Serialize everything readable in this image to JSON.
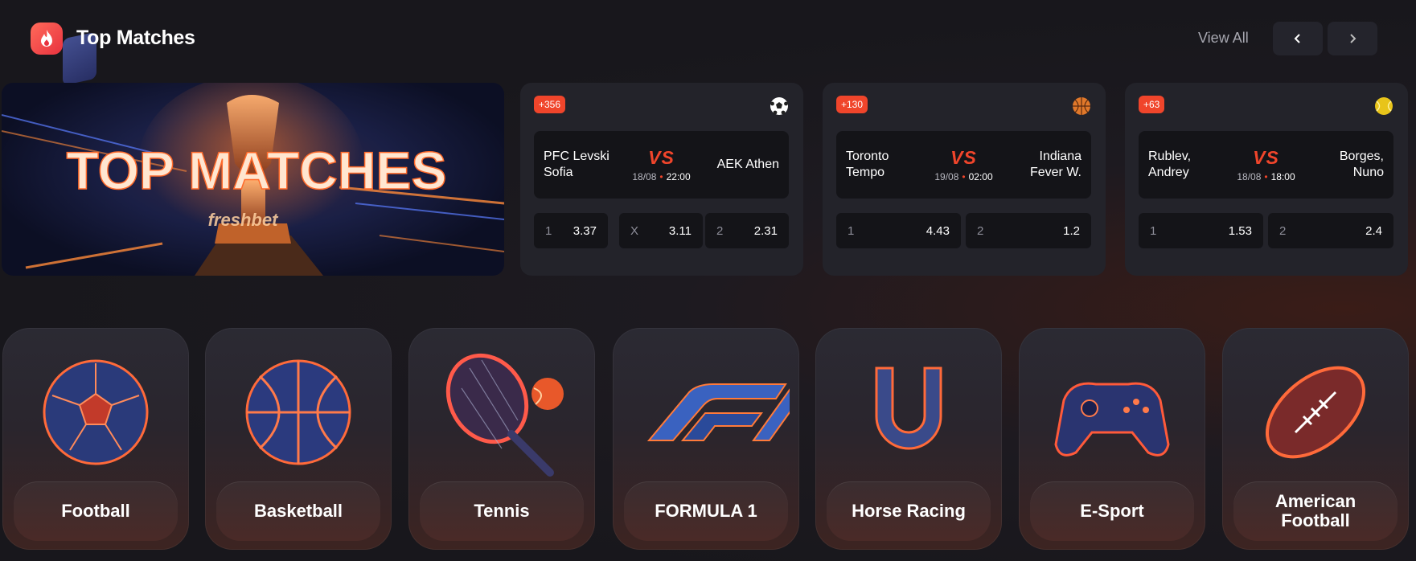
{
  "header": {
    "title": "Top Matches",
    "view_all": "View All",
    "prev_icon": "chevron-left-icon",
    "next_icon": "chevron-right-icon",
    "logo_icon": "flame-icon"
  },
  "banner": {
    "text": "TOP MATCHES",
    "brand": "freshbet"
  },
  "matches": [
    {
      "count_badge": "+356",
      "sport_icon": "football-icon",
      "team_a": [
        "PFC Levski",
        "Sofia"
      ],
      "team_b": [
        "AEK Athen"
      ],
      "vs": "VS",
      "date": "18/08",
      "time": "22:00",
      "odds": [
        {
          "label": "1",
          "value": "3.37"
        },
        {
          "label": "X",
          "value": "3.11"
        },
        {
          "label": "2",
          "value": "2.31"
        }
      ]
    },
    {
      "count_badge": "+130",
      "sport_icon": "basketball-icon",
      "team_a": [
        "Toronto",
        "Tempo"
      ],
      "team_b": [
        "Indiana",
        "Fever W."
      ],
      "vs": "VS",
      "date": "19/08",
      "time": "02:00",
      "odds": [
        {
          "label": "1",
          "value": "4.43"
        },
        {
          "label": "2",
          "value": "1.2"
        }
      ]
    },
    {
      "count_badge": "+63",
      "sport_icon": "tennis-ball-icon",
      "team_a": [
        "Rublev,",
        "Andrey"
      ],
      "team_b": [
        "Borges,",
        "Nuno"
      ],
      "vs": "VS",
      "date": "18/08",
      "time": "18:00",
      "odds": [
        {
          "label": "1",
          "value": "1.53"
        },
        {
          "label": "2",
          "value": "2.4"
        }
      ]
    }
  ],
  "categories": [
    {
      "label": "Football",
      "icon": "soccer-ball-icon"
    },
    {
      "label": "Basketball",
      "icon": "basketball-icon"
    },
    {
      "label": "Tennis",
      "icon": "tennis-racket-icon"
    },
    {
      "label": "FORMULA 1",
      "icon": "f1-logo-icon"
    },
    {
      "label": "Horse Racing",
      "icon": "horseshoe-icon"
    },
    {
      "label": "E-Sport",
      "icon": "gamepad-icon"
    },
    {
      "label": "American Football",
      "icon": "american-football-icon"
    }
  ],
  "colors": {
    "accent": "#f0452b",
    "card_bg": "#23232a",
    "inner_bg": "#141418",
    "page_bg": "#18171c"
  }
}
